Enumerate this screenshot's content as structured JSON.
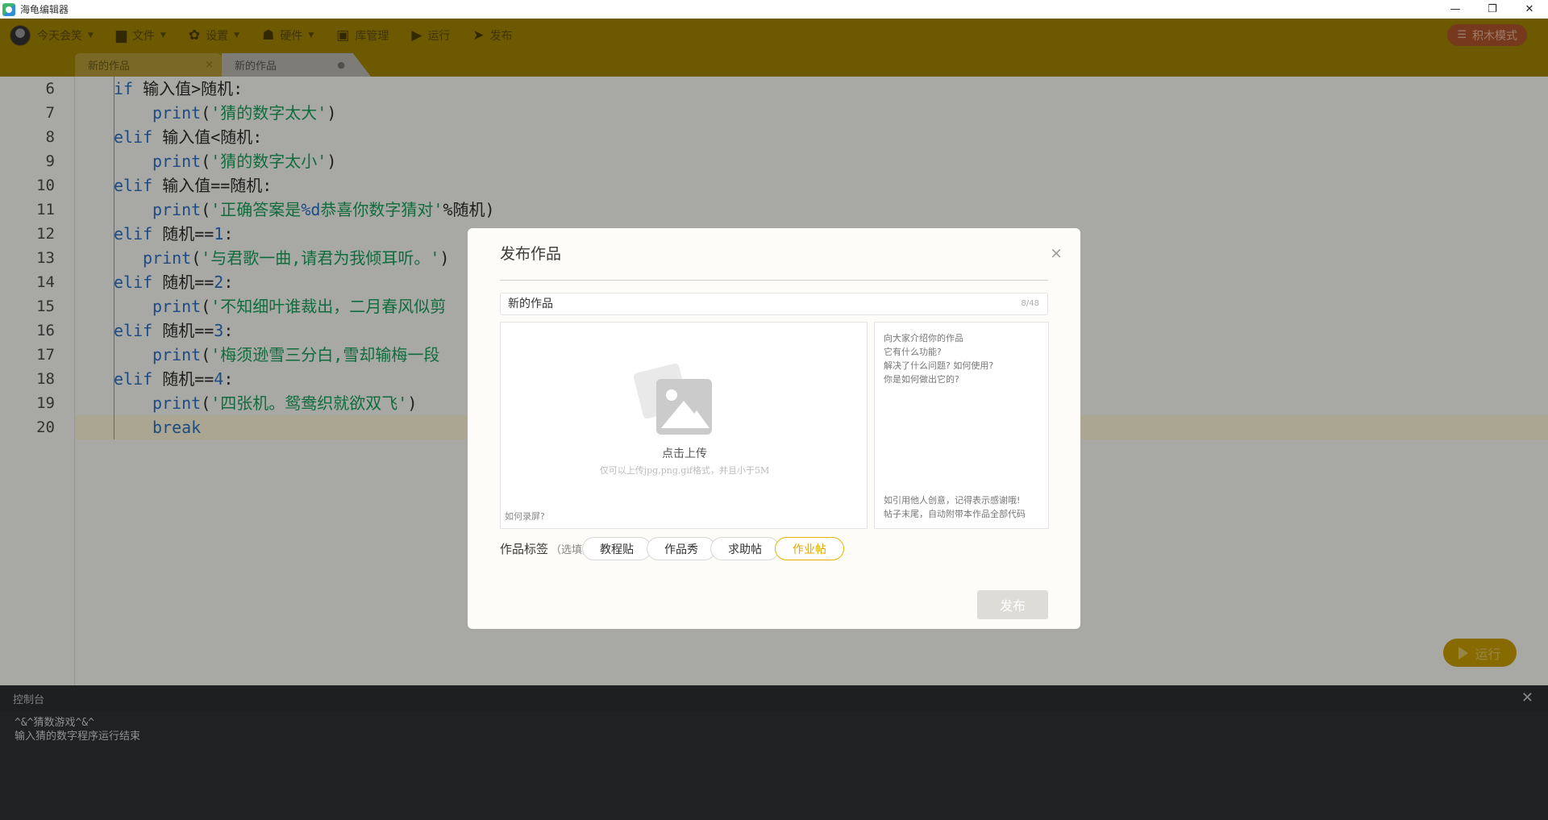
{
  "window": {
    "title": "海龟编辑器",
    "min": "—",
    "restore": "❐",
    "close": "✕"
  },
  "toolbar": {
    "user": "今天会笑",
    "file": "文件",
    "settings": "设置",
    "hardware": "硬件",
    "library": "库管理",
    "run": "运行",
    "publish": "发布",
    "block_mode": "积木模式"
  },
  "tabs": [
    {
      "label": "新的作品",
      "close": "×"
    },
    {
      "label": "新的作品",
      "dot": "●"
    }
  ],
  "code": {
    "lines": [
      {
        "n": "6",
        "kw": "if",
        "text": " 输入值>随机:"
      },
      {
        "n": "7",
        "fn": "print(",
        "str": "'猜的数字太大'",
        "end": ")"
      },
      {
        "n": "8",
        "kw": "elif",
        "text": " 输入值<随机:"
      },
      {
        "n": "9",
        "fn": "print(",
        "str": "'猜的数字太小'",
        "end": ")"
      },
      {
        "n": "10",
        "kw": "elif",
        "text": " 输入值==随机:"
      },
      {
        "n": "11",
        "fn": "print(",
        "str": "'正确答案是%d恭喜你数字猜对'",
        "end": "%随机)"
      },
      {
        "n": "12",
        "kw": "elif",
        "text": " 随机==",
        "num": "1",
        "end": ":"
      },
      {
        "n": "13",
        "fn": "print(",
        "str": "'与君歌一曲,请君为我倾耳听。'",
        "end": ")"
      },
      {
        "n": "14",
        "kw": "elif",
        "text": " 随机==",
        "num": "2",
        "end": ":"
      },
      {
        "n": "15",
        "fn": "print(",
        "str": "'不知细叶谁裁出，二月春风似剪",
        "end": ""
      },
      {
        "n": "16",
        "kw": "elif",
        "text": " 随机==",
        "num": "3",
        "end": ":"
      },
      {
        "n": "17",
        "fn": "print(",
        "str": "'梅须逊雪三分白,雪却输梅一段",
        "end": ""
      },
      {
        "n": "18",
        "kw": "elif",
        "text": " 随机==",
        "num": "4",
        "end": ":"
      },
      {
        "n": "19",
        "fn": "print(",
        "str": "'四张机。鸳鸯织就欲双飞'",
        "end": ")"
      },
      {
        "n": "20",
        "kwonly": "break"
      }
    ]
  },
  "run_button": "运行",
  "console": {
    "title": "控制台",
    "close": "✕",
    "lines": [
      "^&^猜数游戏^&^",
      "输入猜的数字程序运行结束"
    ]
  },
  "modal": {
    "title": "发布作品",
    "close": "×",
    "name_value": "新的作品",
    "name_count": "8/48",
    "upload_label": "点击上传",
    "upload_hint": "仅可以上传jpg,png,gif格式，并且小于5M",
    "record_link": "如何录屏?",
    "desc_placeholder": [
      "向大家介绍你的作品",
      "它有什么功能?",
      "解决了什么问题? 如何使用?",
      "你是如何做出它的?"
    ],
    "desc_footer": [
      "如引用他人创意，记得表示感谢哦!",
      "帖子末尾，自动附带本作品全部代码"
    ],
    "tag_label": "作品标签",
    "tag_optional": "（选填）",
    "tags": [
      {
        "label": "教程贴",
        "selected": false
      },
      {
        "label": "作品秀",
        "selected": false
      },
      {
        "label": "求助帖",
        "selected": false
      },
      {
        "label": "作业帖",
        "selected": true
      }
    ],
    "publish_button": "发布"
  },
  "colors": {
    "toolbar": "#a18300",
    "accent": "#e8b400",
    "keyword": "#2c6fc2",
    "string": "#18a05a"
  }
}
